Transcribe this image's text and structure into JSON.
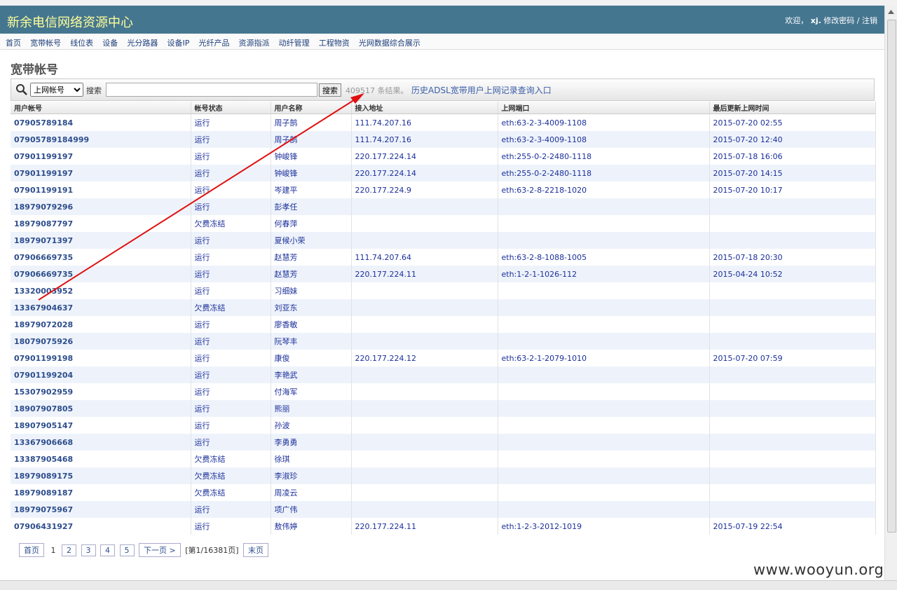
{
  "header": {
    "title": "新余电信网络资源中心",
    "welcome": "欢迎，",
    "username": "xj.",
    "change_password": "修改密码",
    "separator": "/",
    "logout": "注销"
  },
  "nav": [
    "首页",
    "宽带帐号",
    "线位表",
    "设备",
    "光分路器",
    "设备IP",
    "光纤产品",
    "资源指派",
    "动纤管理",
    "工程物资",
    "光网数据综合展示"
  ],
  "page_title": "宽带帐号",
  "search": {
    "select_value": "上网帐号",
    "label": "搜索",
    "input_value": "",
    "button": "搜索",
    "result_count": "409517 条结果。",
    "history_link": "历史ADSL宽带用户上网记录查询入口"
  },
  "table": {
    "columns": [
      "用户帐号",
      "帐号状态",
      "用户名称",
      "接入地址",
      "上网端口",
      "最后更新上网时间"
    ],
    "rows": [
      [
        "07905789184",
        "运行",
        "周子鹄",
        "111.74.207.16",
        "eth:63-2-3-4009-1108",
        "2015-07-20 02:55"
      ],
      [
        "07905789184999",
        "运行",
        "周子鹄",
        "111.74.207.16",
        "eth:63-2-3-4009-1108",
        "2015-07-20 12:40"
      ],
      [
        "07901199197",
        "运行",
        "钟峻锋",
        "220.177.224.14",
        "eth:255-0-2-2480-1118",
        "2015-07-18 16:06"
      ],
      [
        "07901199197",
        "运行",
        "钟峻锋",
        "220.177.224.14",
        "eth:255-0-2-2480-1118",
        "2015-07-20 14:15"
      ],
      [
        "07901199191",
        "运行",
        "岑建平",
        "220.177.224.9",
        "eth:63-2-8-2218-1020",
        "2015-07-20 10:17"
      ],
      [
        "18979079296",
        "运行",
        "彭孝任",
        "",
        "",
        ""
      ],
      [
        "18979087797",
        "欠费冻结",
        "何春萍",
        "",
        "",
        ""
      ],
      [
        "18979071397",
        "运行",
        "夏候小荣",
        "",
        "",
        ""
      ],
      [
        "07906669735",
        "运行",
        "赵慧芳",
        "111.74.207.64",
        "eth:63-2-8-1088-1005",
        "2015-07-18 20:30"
      ],
      [
        "07906669735",
        "运行",
        "赵慧芳",
        "220.177.224.11",
        "eth:1-2-1-1026-112",
        "2015-04-24 10:52"
      ],
      [
        "13320003952",
        "运行",
        "习细妹",
        "",
        "",
        ""
      ],
      [
        "13367904637",
        "欠费冻结",
        "刘亚东",
        "",
        "",
        ""
      ],
      [
        "18979072028",
        "运行",
        "廖香敏",
        "",
        "",
        ""
      ],
      [
        "18079075926",
        "运行",
        "阮琴丰",
        "",
        "",
        ""
      ],
      [
        "07901199198",
        "运行",
        "康俊",
        "220.177.224.12",
        "eth:63-2-1-2079-1010",
        "2015-07-20 07:59"
      ],
      [
        "07901199204",
        "运行",
        "李艳武",
        "",
        "",
        ""
      ],
      [
        "15307902959",
        "运行",
        "付海军",
        "",
        "",
        ""
      ],
      [
        "18907907805",
        "运行",
        "熊丽",
        "",
        "",
        ""
      ],
      [
        "18907905147",
        "运行",
        "孙波",
        "",
        "",
        ""
      ],
      [
        "13367906668",
        "运行",
        "李勇勇",
        "",
        "",
        ""
      ],
      [
        "13387905468",
        "欠费冻结",
        "徐琪",
        "",
        "",
        ""
      ],
      [
        "18979089175",
        "欠费冻结",
        "李淑珍",
        "",
        "",
        ""
      ],
      [
        "18979089187",
        "欠费冻结",
        "周凌云",
        "",
        "",
        ""
      ],
      [
        "18979075967",
        "运行",
        "项广伟",
        "",
        "",
        ""
      ],
      [
        "07906431927",
        "运行",
        "敖伟婷",
        "220.177.224.11",
        "eth:1-2-3-2012-1019",
        "2015-07-19 22:54"
      ]
    ]
  },
  "pager": {
    "first": "首页",
    "current": "1",
    "pages": [
      "2",
      "3",
      "4",
      "5"
    ],
    "next": "下一页 >",
    "info": "[第1/16381页]",
    "last": "末页"
  },
  "watermark": "www.wooyun.org",
  "colors": {
    "header_bg": "#457690",
    "title": "#ffff99",
    "link": "#2d4d8c",
    "arrow": "#e01010"
  }
}
